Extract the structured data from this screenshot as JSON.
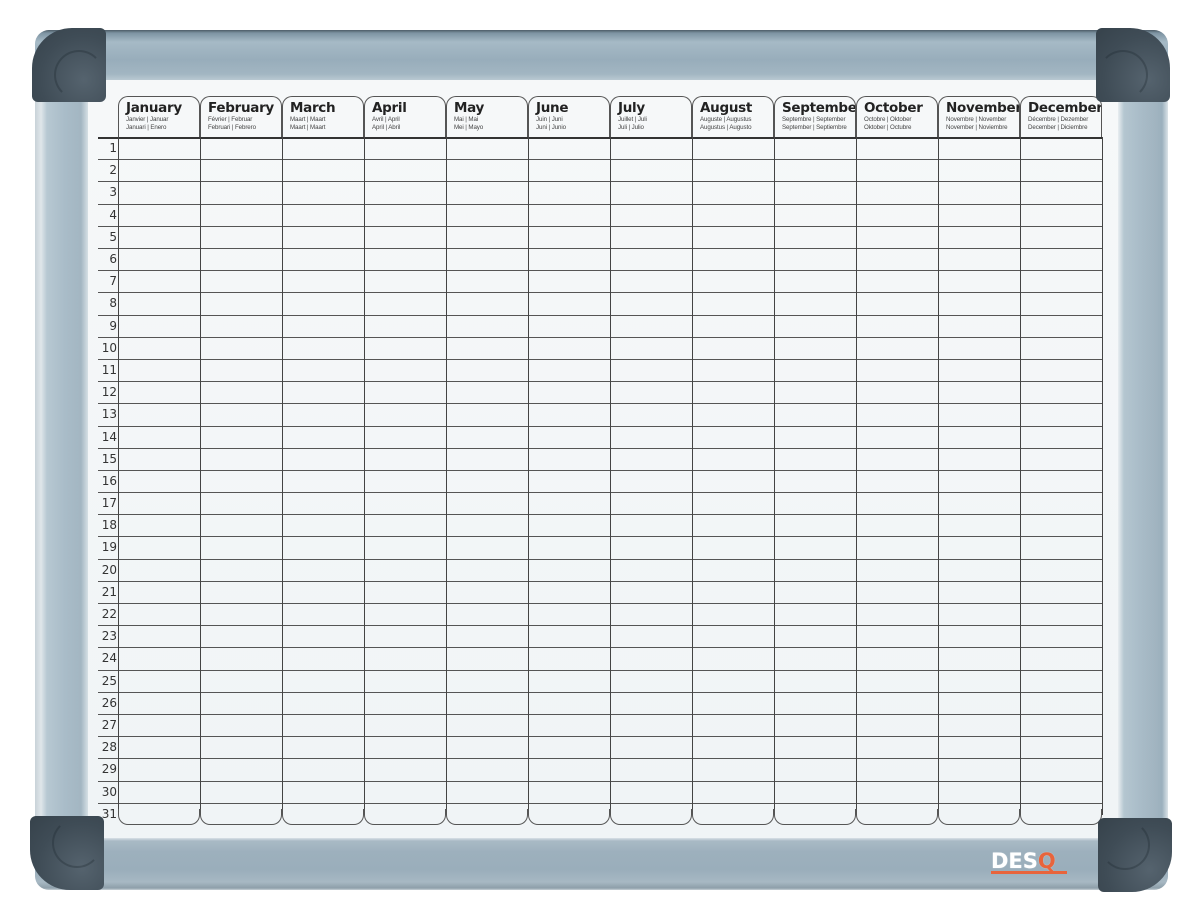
{
  "brand": {
    "logo_text_main": "DES",
    "logo_text_accent": "Q",
    "accent_color": "#e8643c"
  },
  "planner": {
    "months": [
      {
        "name": "January",
        "sub1": "Janvier | Januar",
        "sub2": "Januari | Enero"
      },
      {
        "name": "February",
        "sub1": "Février | Februar",
        "sub2": "Februari | Febrero"
      },
      {
        "name": "March",
        "sub1": "Maart | Maart",
        "sub2": "Maart | Maart"
      },
      {
        "name": "April",
        "sub1": "Avril | April",
        "sub2": "April | Abril"
      },
      {
        "name": "May",
        "sub1": "Mai | Mai",
        "sub2": "Mei | Mayo"
      },
      {
        "name": "June",
        "sub1": "Juin | Juni",
        "sub2": "Juni | Junio"
      },
      {
        "name": "July",
        "sub1": "Juillet | Juli",
        "sub2": "Juli | Julio"
      },
      {
        "name": "August",
        "sub1": "Auguste | Augustus",
        "sub2": "Augustus | Augusto"
      },
      {
        "name": "September",
        "sub1": "Septembre | September",
        "sub2": "September | Septiembre"
      },
      {
        "name": "October",
        "sub1": "Octobre | Oktober",
        "sub2": "Oktober | Octubre"
      },
      {
        "name": "November",
        "sub1": "Novembre | November",
        "sub2": "November | Noviembre"
      },
      {
        "name": "December",
        "sub1": "Décembre | Dezember",
        "sub2": "December | Diciembre"
      }
    ],
    "days": [
      "1",
      "2",
      "3",
      "4",
      "5",
      "6",
      "7",
      "8",
      "9",
      "10",
      "11",
      "12",
      "13",
      "14",
      "15",
      "16",
      "17",
      "18",
      "19",
      "20",
      "21",
      "22",
      "23",
      "24",
      "25",
      "26",
      "27",
      "28",
      "29",
      "30",
      "31"
    ]
  }
}
